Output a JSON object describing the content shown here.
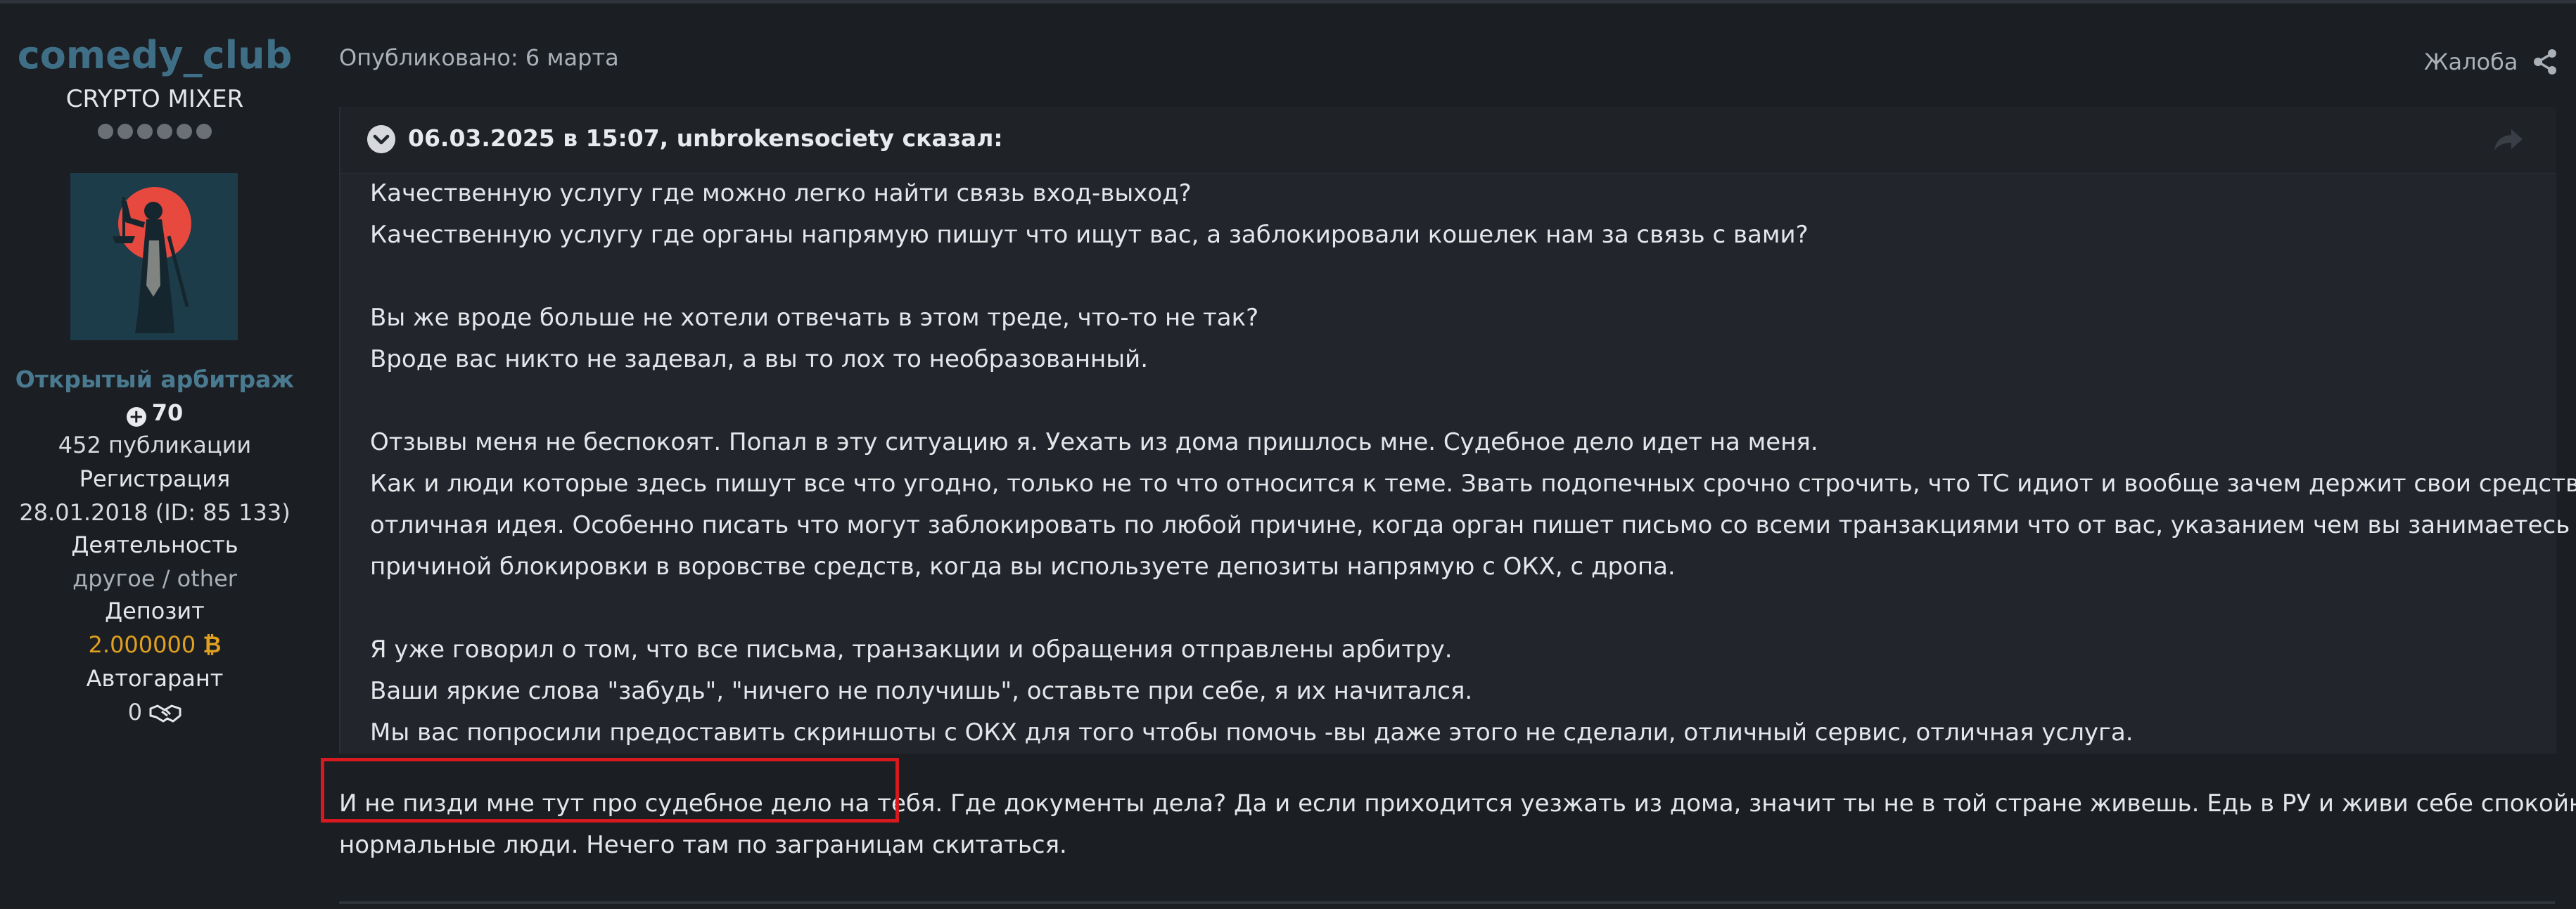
{
  "author": {
    "username": "comedy_club",
    "user_title": "CRYPTO MIXER",
    "rank_pips": 6,
    "group": "Открытый арбитраж",
    "reputation": "70",
    "posts": "452 публикации",
    "registration_label": "Регистрация",
    "registration_value": "28.01.2018 (ID: 85 133)",
    "activity_label": "Деятельность",
    "activity_value": "другое / other",
    "deposit_label": "Депозит",
    "deposit_value": "2.000000",
    "deposit_currency_icon": "bitcoin-icon",
    "guarantor_label": "Автогарант",
    "guarantor_value": "0",
    "guarantor_icon": "handshake-icon"
  },
  "post": {
    "published": "Опубликовано: 6 марта",
    "report_label": "Жалоба",
    "share_icon": "share-icon"
  },
  "quote": {
    "attribution": "06.03.2025 в 15:07, unbrokensociety сказал:",
    "lines": [
      "Качественную услугу где можно легко найти связь вход-выход?",
      "Качественную услугу где органы напрямую пишут что ищут вас, а заблокировали кошелек нам за связь с вами?",
      "",
      "Вы же вроде больше не хотели отвечать в этом треде, что-то не так?",
      "Вроде вас никто не задевал, а вы то лох то необразованный.",
      "",
      "Отзывы меня не беспокоят. Попал в эту ситуацию я. Уехать из дома пришлось мне. Судебное дело идет на меня.",
      "Как и люди которые здесь пишут все что угодно, только не то что относится к теме. Звать подопечных срочно строчить, что ТС идиот и вообще зачем держит свои средства в USDT",
      "отличная идея. Особенно писать что могут заблокировать по любой причине, когда орган пишет письмо со всеми транзакциями что от вас, указанием чем вы занимаетесь и",
      "причиной блокировки в воровстве средств, когда вы используете депозиты напрямую с ОКХ, с дропа.",
      "",
      "Я уже говорил о том, что все письма, транзакции и обращения отправлены арбитру.",
      "Ваши яркие слова \"забудь\", \"ничего не получишь\", оставьте при себе, я их начитался.",
      "Мы вас попросили предоставить скриншоты с ОКХ для того чтобы помочь -вы даже этого не сделали, отличный сервис, отличная услуга."
    ]
  },
  "reply": {
    "lines": [
      "И не пизди мне тут про судебное дело на тебя. Где документы дела? Да и если приходится уезжать из дома, значит ты не в той стране живешь. Едь в РУ и живи себе спокойно, как",
      "нормальные люди. Нечего там по заграницам скитаться."
    ]
  },
  "colors": {
    "background": "#1b1e23",
    "username": "#3f6f86",
    "deposit": "#e0a020",
    "highlight_box": "#d71920"
  }
}
